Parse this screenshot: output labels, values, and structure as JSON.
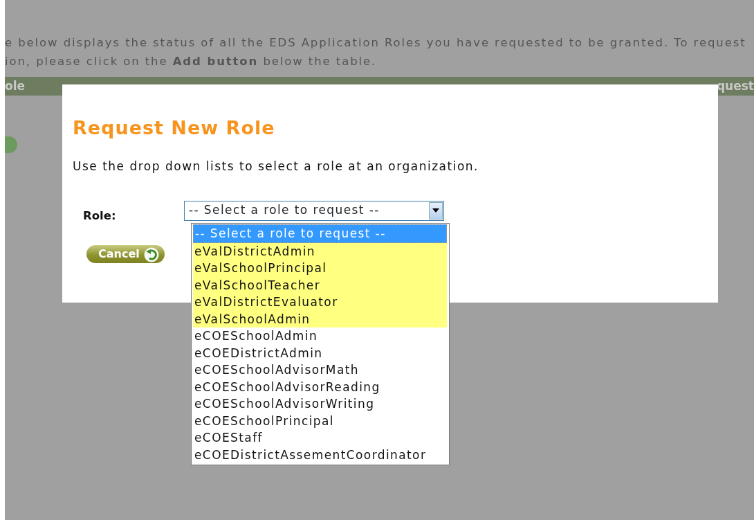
{
  "page": {
    "intro_lines": [
      "e below displays the status of all the EDS Application Roles you have requested to be granted. To request",
      "ion, please click on the **Add button** below the table."
    ],
    "table_headers": [
      "ole",
      "quest"
    ]
  },
  "dialog": {
    "title": "Request New Role",
    "instructions": "Use the drop down lists to select a role at an organization.",
    "role_label": "Role:",
    "role_select": {
      "value": "-- Select a role to request --",
      "expanded": true,
      "options": [
        {
          "label": "-- Select a role to request --",
          "selected": true,
          "highlighted": false
        },
        {
          "label": "eValDistrictAdmin",
          "selected": false,
          "highlighted": true
        },
        {
          "label": "eValSchoolPrincipal",
          "selected": false,
          "highlighted": true
        },
        {
          "label": "eValSchoolTeacher",
          "selected": false,
          "highlighted": true
        },
        {
          "label": "eValDistrictEvaluator",
          "selected": false,
          "highlighted": true
        },
        {
          "label": "eValSchoolAdmin",
          "selected": false,
          "highlighted": true
        },
        {
          "label": "eCOESchoolAdmin",
          "selected": false,
          "highlighted": false
        },
        {
          "label": "eCOEDistrictAdmin",
          "selected": false,
          "highlighted": false
        },
        {
          "label": "eCOESchoolAdvisorMath",
          "selected": false,
          "highlighted": false
        },
        {
          "label": "eCOESchoolAdvisorReading",
          "selected": false,
          "highlighted": false
        },
        {
          "label": "eCOESchoolAdvisorWriting",
          "selected": false,
          "highlighted": false
        },
        {
          "label": "eCOESchoolPrincipal",
          "selected": false,
          "highlighted": false
        },
        {
          "label": "eCOEStaff",
          "selected": false,
          "highlighted": false
        },
        {
          "label": "eCOEDistrictAssementCoordinator",
          "selected": false,
          "highlighted": false
        }
      ]
    },
    "cancel_button": "Cancel"
  }
}
